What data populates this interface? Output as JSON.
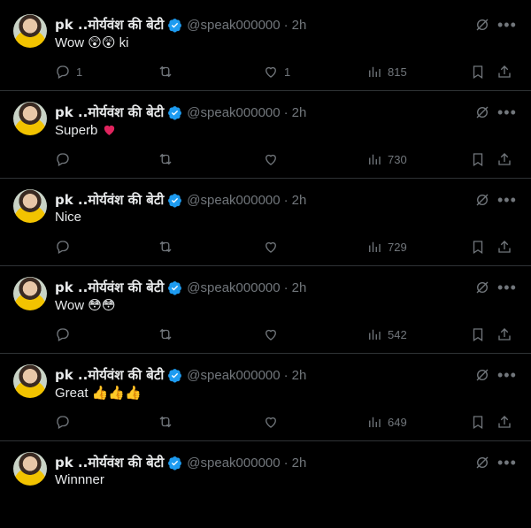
{
  "tweets": [
    {
      "name": "pk ..मोर्यवंश की बेटी",
      "handle": "@speak000000",
      "time": "2h",
      "text": "Wow",
      "emoji": "😲😲",
      "suffix": " ki",
      "replies": "1",
      "retweets": "",
      "likes": "1",
      "views": "815",
      "heart": "none"
    },
    {
      "name": "pk ..मोर्यवंश की बेटी",
      "handle": "@speak000000",
      "time": "2h",
      "text": "Superb",
      "emoji": "❤️",
      "suffix": "",
      "replies": "",
      "retweets": "",
      "likes": "",
      "views": "730",
      "heart": "red"
    },
    {
      "name": "pk ..मोर्यवंश की बेटी",
      "handle": "@speak000000",
      "time": "2h",
      "text": "Nice",
      "emoji": "",
      "suffix": "",
      "replies": "",
      "retweets": "",
      "likes": "",
      "views": "729"
    },
    {
      "name": "pk ..मोर्यवंश की बेटी",
      "handle": "@speak000000",
      "time": "2h",
      "text": "Wow",
      "emoji": "😳😳",
      "suffix": "",
      "replies": "",
      "retweets": "",
      "likes": "",
      "views": "542"
    },
    {
      "name": "pk ..मोर्यवंश की बेटी",
      "handle": "@speak000000",
      "time": "2h",
      "text": "Great",
      "emoji": "👍👍👍",
      "suffix": "",
      "replies": "",
      "retweets": "",
      "likes": "",
      "views": "649"
    },
    {
      "name": "pk ..मोर्यवंश की बेटी",
      "handle": "@speak000000",
      "time": "2h",
      "text": "Winnner",
      "emoji": "",
      "suffix": "",
      "replies": "",
      "retweets": "",
      "likes": "",
      "views": ""
    }
  ],
  "separator": "·",
  "more_glyph": "•••",
  "colors": {
    "background": "#000000",
    "text": "#e7e9ea",
    "muted": "#71767b",
    "verified": "#1d9bf0",
    "divider": "#2f3336"
  }
}
